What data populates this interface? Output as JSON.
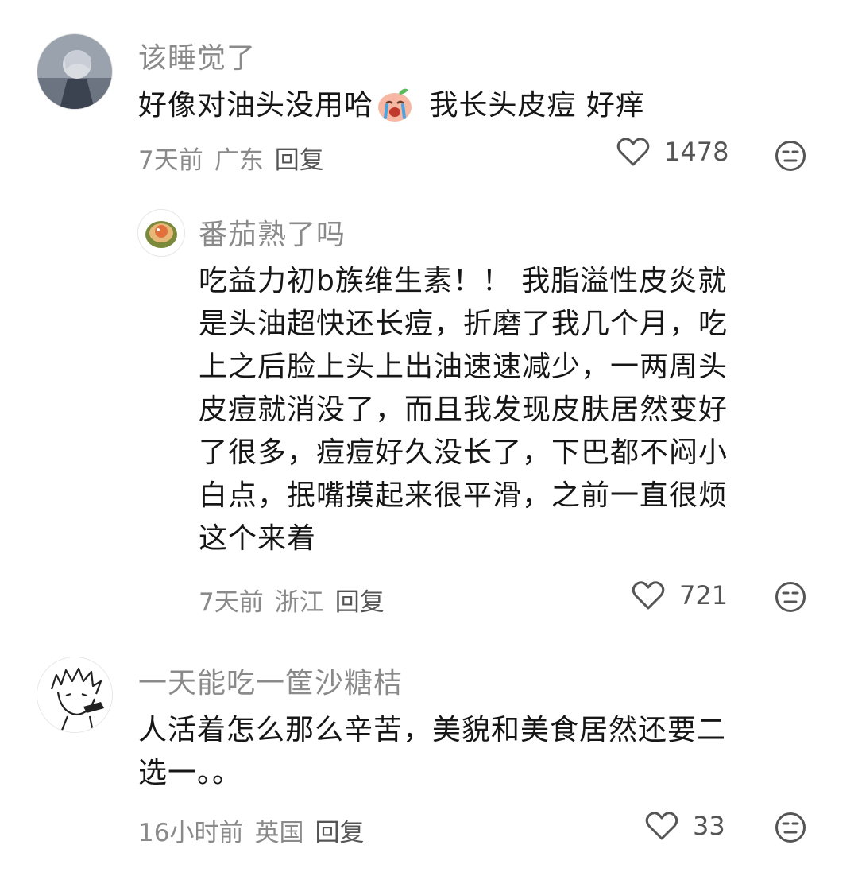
{
  "comments": [
    {
      "username": "该睡觉了",
      "text_before_emoji": "好像对油头没用哈",
      "emoji": "crying-face-emoji",
      "text_after_emoji": " 我长头皮痘 好痒",
      "time": "7天前",
      "location": "广东",
      "reply_label": "回复",
      "likes": "1478"
    },
    {
      "username": "番茄熟了吗",
      "lines": [
        "吃益力初b族维生素！！ 我脂溢性皮炎就",
        "是头油超快还长痘，折磨了我几个月，吃",
        "上之后脸上头上出油速速减少，一两周头",
        "皮痘就消没了，而且我发现皮肤居然变好",
        "了很多，痘痘好久没长了，下巴都不闷小",
        "白点，抿嘴摸起来很平滑，之前一直很烦",
        "这个来着"
      ],
      "time": "7天前",
      "location": "浙江",
      "reply_label": "回复",
      "likes": "721"
    },
    {
      "username": "一天能吃一筐沙糖桔",
      "lines": [
        "人活着怎么那么辛苦，美貌和美食居然还要二",
        "选一。。"
      ],
      "time": "16小时前",
      "location": "英国",
      "reply_label": "回复",
      "likes": "33"
    }
  ],
  "colors": {
    "muted": "#8a8a8a",
    "text": "#161616",
    "icon": "#555555"
  }
}
